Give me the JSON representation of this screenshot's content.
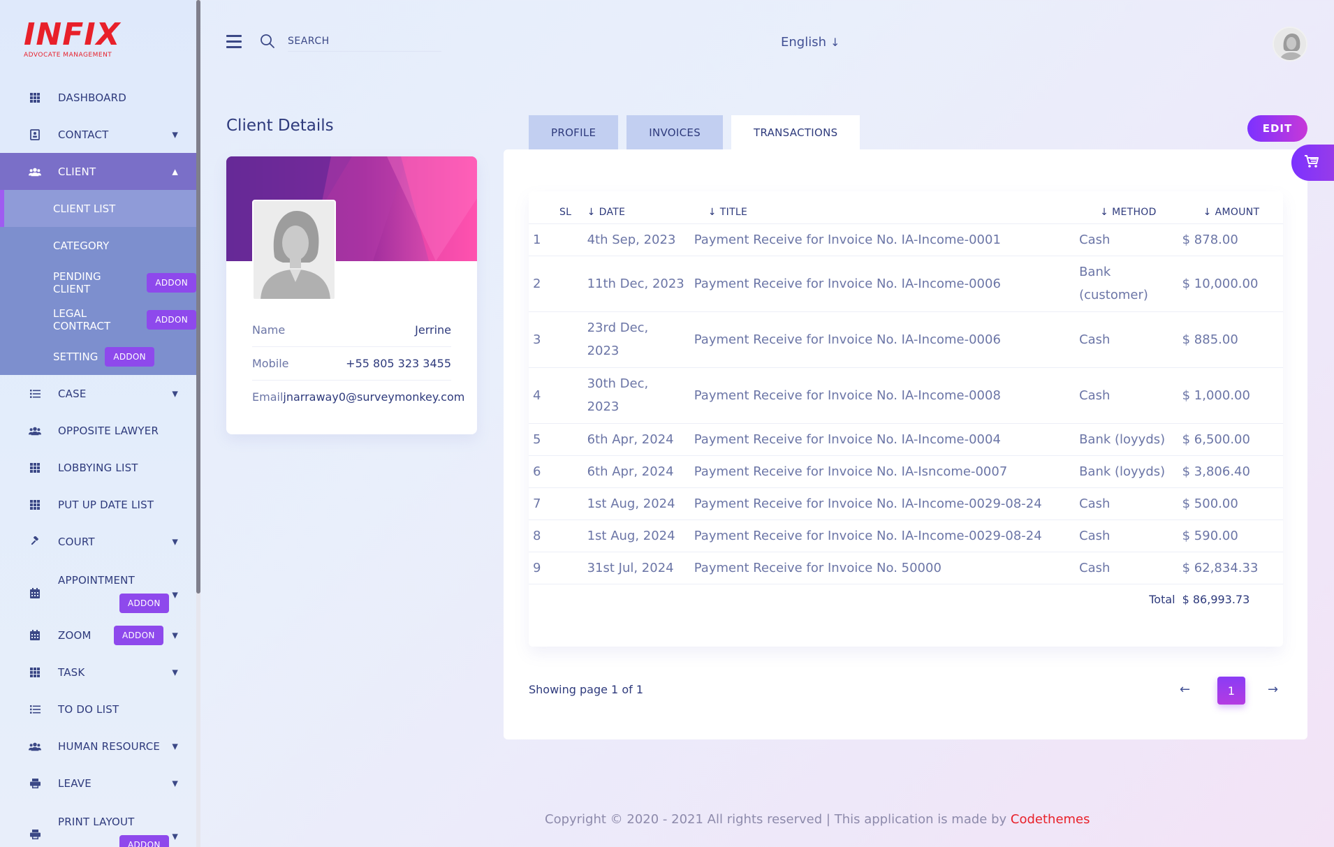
{
  "brand": {
    "logo": "INFIX",
    "tagline": "ADVOCATE MANAGEMENT"
  },
  "sidebar": {
    "items": [
      {
        "label": "DASHBOARD",
        "icon": "grid-icon"
      },
      {
        "label": "CONTACT",
        "icon": "contact-book-icon",
        "expandable": true
      },
      {
        "label": "CLIENT",
        "icon": "users-icon",
        "expanded": true
      },
      {
        "label": "CASE",
        "icon": "list-icon",
        "expandable": true
      },
      {
        "label": "OPPOSITE LAWYER",
        "icon": "users-icon"
      },
      {
        "label": "LOBBYING LIST",
        "icon": "grid-icon"
      },
      {
        "label": "PUT UP DATE LIST",
        "icon": "grid-icon"
      },
      {
        "label": "COURT",
        "icon": "gavel-icon",
        "expandable": true
      },
      {
        "label": "APPOINTMENT",
        "icon": "calendar-icon",
        "badge": "ADDON",
        "expandable": true
      },
      {
        "label": "ZOOM",
        "icon": "calendar-icon",
        "badge": "ADDON",
        "expandable": true
      },
      {
        "label": "TASK",
        "icon": "grid-icon",
        "expandable": true
      },
      {
        "label": "TO DO LIST",
        "icon": "list-icon"
      },
      {
        "label": "HUMAN RESOURCE",
        "icon": "users-icon",
        "expandable": true
      },
      {
        "label": "LEAVE",
        "icon": "printer-icon",
        "expandable": true
      },
      {
        "label": "PRINT LAYOUT",
        "icon": "printer-icon",
        "badge": "ADDON",
        "expandable": true
      }
    ],
    "client_submenu": [
      {
        "label": "CLIENT LIST",
        "current": true
      },
      {
        "label": "CATEGORY"
      },
      {
        "label": "PENDING CLIENT",
        "badge": "ADDON"
      },
      {
        "label": "LEGAL CONTRACT",
        "badge": "ADDON"
      },
      {
        "label": "SETTING",
        "badge": "ADDON"
      }
    ]
  },
  "header": {
    "search_placeholder": "SEARCH",
    "language": "English"
  },
  "page": {
    "title": "Client Details"
  },
  "profile": {
    "name_label": "Name",
    "name": "Jerrine",
    "mobile_label": "Mobile",
    "mobile": "+55 805 323 3455",
    "email_label": "Email",
    "email": "jnarraway0@surveymonkey.com"
  },
  "tabs": [
    "PROFILE",
    "INVOICES",
    "TRANSACTIONS"
  ],
  "active_tab": "TRANSACTIONS",
  "edit_label": "EDIT",
  "table": {
    "headers": {
      "sl": "SL",
      "date": "DATE",
      "title": "TITLE",
      "method": "METHOD",
      "amount": "AMOUNT"
    },
    "rows": [
      {
        "sl": "1",
        "date": "4th Sep, 2023",
        "title": "Payment Receive for Invoice No. IA-Income-0001",
        "method": "Cash",
        "amount": "$ 878.00"
      },
      {
        "sl": "2",
        "date": "11th Dec, 2023",
        "title": "Payment Receive for Invoice No. IA-Income-0006",
        "method": "Bank (customer)",
        "amount": "$ 10,000.00"
      },
      {
        "sl": "3",
        "date": "23rd Dec, 2023",
        "title": "Payment Receive for Invoice No. IA-Income-0006",
        "method": "Cash",
        "amount": "$ 885.00"
      },
      {
        "sl": "4",
        "date": "30th Dec, 2023",
        "title": "Payment Receive for Invoice No. IA-Income-0008",
        "method": "Cash",
        "amount": "$ 1,000.00"
      },
      {
        "sl": "5",
        "date": "6th Apr, 2024",
        "title": "Payment Receive for Invoice No. IA-Income-0004",
        "method": "Bank (loyyds)",
        "amount": "$ 6,500.00"
      },
      {
        "sl": "6",
        "date": "6th Apr, 2024",
        "title": "Payment Receive for Invoice No. IA-Isncome-0007",
        "method": "Bank (loyyds)",
        "amount": "$ 3,806.40"
      },
      {
        "sl": "7",
        "date": "1st Aug, 2024",
        "title": "Payment Receive for Invoice No. IA-Income-0029-08-24",
        "method": "Cash",
        "amount": "$ 500.00"
      },
      {
        "sl": "8",
        "date": "1st Aug, 2024",
        "title": "Payment Receive for Invoice No. IA-Income-0029-08-24",
        "method": "Cash",
        "amount": "$ 590.00"
      },
      {
        "sl": "9",
        "date": "31st Jul, 2024",
        "title": "Payment Receive for Invoice No. 50000",
        "method": "Cash",
        "amount": "$ 62,834.33"
      }
    ],
    "total_label": "Total",
    "total": "$ 86,993.73"
  },
  "pagination": {
    "summary": "Showing page 1 of 1",
    "current": "1",
    "prev": "←",
    "next": "→"
  },
  "footer": {
    "text": "Copyright © 2020 - 2021 All rights reserved | This application is made by ",
    "brand": "Codethemes"
  },
  "colors": {
    "accent": "#7c32ff",
    "brand_red": "#e8202a",
    "text": "#415094",
    "active_nav": "#7a6fc8"
  }
}
